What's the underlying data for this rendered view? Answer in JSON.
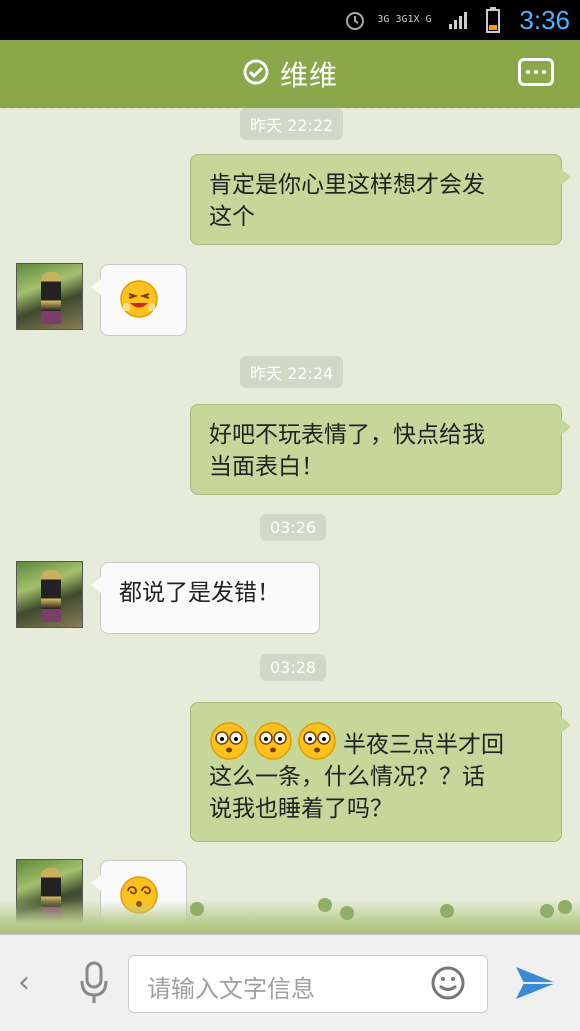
{
  "status_bar": {
    "network_text": "3G 3G1X G",
    "time": "3:36",
    "icons": [
      "alarm-icon",
      "network-icon",
      "signal-icon",
      "battery-icon"
    ]
  },
  "header": {
    "title": "维维",
    "left_icon": "check-circle-icon",
    "right_icon": "more-icon"
  },
  "messages": [
    {
      "type": "time",
      "text": "昨天 22:22"
    },
    {
      "type": "right",
      "text": "肯定是你心里这样想才会发\n这个"
    },
    {
      "type": "left_emoji",
      "emoji": "laughing-emoji"
    },
    {
      "type": "time",
      "text": "昨天 22:24"
    },
    {
      "type": "right",
      "text": "好吧不玩表情了，快点给我\n当面表白！"
    },
    {
      "type": "time",
      "text": "03:26"
    },
    {
      "type": "left",
      "text": "都说了是发错！"
    },
    {
      "type": "time",
      "text": "03:28"
    },
    {
      "type": "right",
      "text": "半夜三点半才回\n这么一条，什么情况？？话\n说我也睡着了吗？",
      "emojis": [
        "shocked-emoji",
        "shocked-emoji",
        "shocked-emoji"
      ]
    },
    {
      "type": "left_emoji",
      "emoji": "dizzy-emoji"
    }
  ],
  "input": {
    "placeholder": "请输入文字信息",
    "back_icon": "chevron-left-icon",
    "mic_icon": "microphone-icon",
    "emoji_icon": "smiley-icon",
    "send_icon": "send-icon"
  },
  "colors": {
    "header": "#8aa84a",
    "chat_bg": "#e6ecd9",
    "bubble_right": "#c6d79a",
    "bubble_left": "#fafafa",
    "time_pill": "#d2d8c8",
    "clock": "#4fb4ff"
  }
}
